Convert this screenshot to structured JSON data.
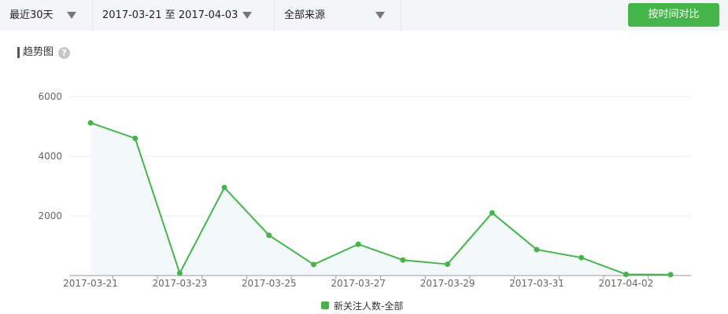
{
  "toolbar": {
    "range_label": "最近30天",
    "date_range_label": "2017-03-21 至 2017-04-03",
    "source_label": "全部来源",
    "compare_button": "按时间对比"
  },
  "chart_title": "趋势图",
  "help_icon": "question-icon",
  "colors": {
    "accent": "#44b549",
    "line": "#44b549",
    "area": "#f3f8fb"
  },
  "chart_data": {
    "type": "line",
    "title": "趋势图",
    "xlabel": "",
    "ylabel": "",
    "ylim": [
      0,
      6000
    ],
    "y_ticks": [
      "2000",
      "4000",
      "6000"
    ],
    "x_tick_labels": [
      "2017-03-21",
      "2017-03-23",
      "2017-03-25",
      "2017-03-27",
      "2017-03-29",
      "2017-03-31",
      "2017-04-02"
    ],
    "x": [
      "2017-03-21",
      "2017-03-22",
      "2017-03-23",
      "2017-03-24",
      "2017-03-25",
      "2017-03-26",
      "2017-03-27",
      "2017-03-28",
      "2017-03-29",
      "2017-03-30",
      "2017-03-31",
      "2017-04-01",
      "2017-04-02",
      "2017-04-03"
    ],
    "series": [
      {
        "name": "新关注人数-全部",
        "values": [
          5120,
          4600,
          80,
          2950,
          1350,
          370,
          1050,
          520,
          380,
          2100,
          870,
          600,
          40,
          30
        ]
      }
    ],
    "grid": true,
    "legend": "bottom-center"
  }
}
